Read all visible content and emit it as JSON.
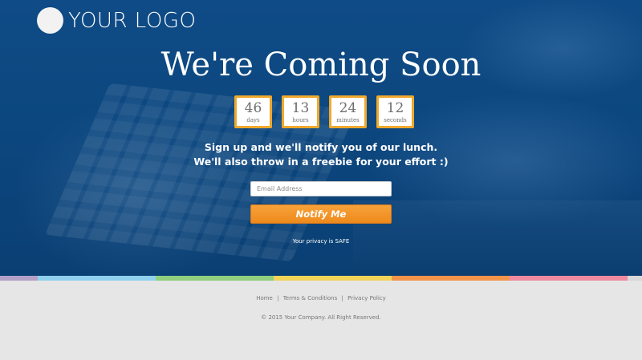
{
  "logo": {
    "text": "YOUR LOGO"
  },
  "hero": {
    "title": "We're Coming Soon",
    "countdown": [
      {
        "value": "46",
        "label": "days"
      },
      {
        "value": "13",
        "label": "hours"
      },
      {
        "value": "24",
        "label": "minutes"
      },
      {
        "value": "12",
        "label": "seconds"
      }
    ],
    "tagline_line1": "Sign up and we'll notify you of our lunch.",
    "tagline_line2": "We'll also throw in a freebie for your effort :)",
    "email_placeholder": "Email Address",
    "notify_label": "Notify Me",
    "privacy": "Your privacy is SAFE"
  },
  "colors": {
    "accent": "#f0a92c",
    "button": "#ee8a1c",
    "hero_bg": "#0c477f",
    "footer_bg": "#e6e6e6",
    "bar": [
      "#b3a0c8",
      "#8ed0ee",
      "#8fcf7e",
      "#f2d458",
      "#f2954a",
      "#ef8aa0",
      "#e6e6e6"
    ]
  },
  "footer": {
    "links": [
      "Home",
      "Terms & Conditions",
      "Privacy Policy"
    ],
    "separator": "|",
    "copyright": "© 2015 Your Company. All Right Reserved."
  }
}
